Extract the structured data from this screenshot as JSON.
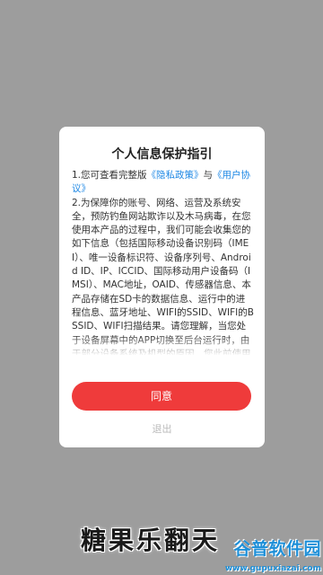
{
  "dialog": {
    "title": "个人信息保护指引",
    "item1_prefix": "1.您可查看完整版",
    "privacy_link": "《隐私政策》",
    "item1_mid": "与",
    "agreement_link": "《用户协议》",
    "item2": "2.为保障你的账号、网络、运营及系统安全，预防钓鱼网站欺诈以及木马病毒，在您使用本产品的过程中，我们可能会收集您的如下信息（包括国际移动设备识别码（IMEI）、唯一设备标识符、设备序列号、Android ID、IP、ICCID、国际移动用户设备码（IMSI）、MAC地址，OAID、传感器信息、本产品存储在SD卡的数据信息、运行中的进程信息、蓝牙地址、WIFI的SSID、WIFI的BSSID、WIFI扫描结果。请您理解，当您处于设备屏幕中的APP切换至后台运行时，由于部分设备系统及机型的原因，您此前使用的相关功能而产生的",
    "agree_label": "同意",
    "exit_label": "退出"
  },
  "overlay": {
    "app_title": "糖果乐翻天"
  },
  "watermark": {
    "logo": "谷普软件园",
    "url": "www.gupuxiazai.com"
  },
  "colors": {
    "backdrop": "#9d9d9d",
    "accent": "#ef3b3b",
    "link": "#1e88e5",
    "watermark": "#1d8fd8"
  }
}
